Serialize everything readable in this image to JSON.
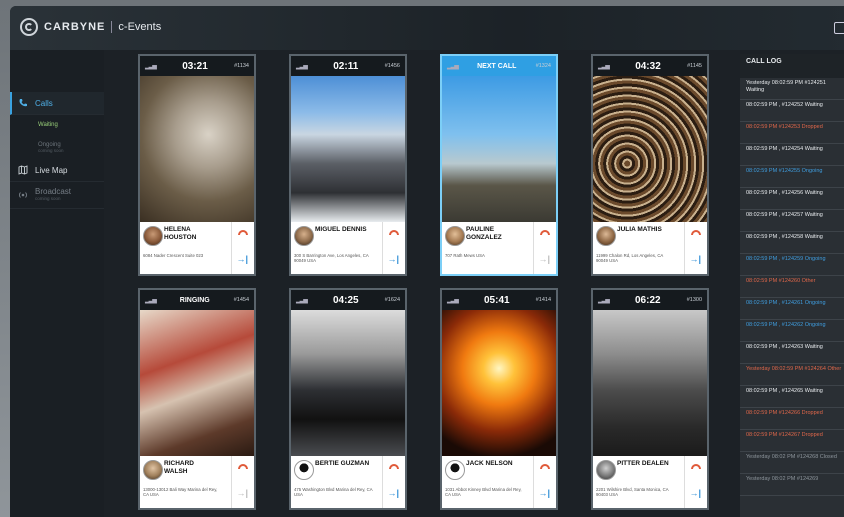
{
  "app": {
    "brand": "CARBYNE",
    "product": "c-Events"
  },
  "sidebar": {
    "items": [
      {
        "label": "Calls",
        "active": true
      },
      {
        "label": "Waiting",
        "sub": true
      },
      {
        "label": "Ongoing",
        "sub": true,
        "note": "coming soon"
      },
      {
        "label": "Live Map"
      },
      {
        "label": "Broadcast",
        "note": "coming soon"
      }
    ]
  },
  "cards": [
    {
      "status": "03:21",
      "id": "#1134",
      "name": "HELENA HOUSTON",
      "address": "6084 Nader Crescent Suite 023",
      "transfer_enabled": true
    },
    {
      "status": "02:11",
      "id": "#1456",
      "name": "MIGUEL DENNIS",
      "address": "300 S Barrington Ave, Los Angeles, CA 90049 USA",
      "transfer_enabled": true
    },
    {
      "status": "NEXT CALL",
      "id": "#1324",
      "name": "PAULINE GONZALEZ",
      "address": "707 Rath Mews USA",
      "transfer_enabled": false,
      "highlight": true
    },
    {
      "status": "04:32",
      "id": "#1145",
      "name": "JULIA MATHIS",
      "address": "11999 Chalon Rd, Los Angeles, CA 90049 USA",
      "transfer_enabled": true
    },
    {
      "status": "RINGING",
      "id": "#1454",
      "name": "RICHARD WALSH",
      "address": "13000-13012 Bali Way Marina del Rey, CA USA",
      "transfer_enabled": false
    },
    {
      "status": "04:25",
      "id": "#1624",
      "name": "BERTIE GUZMAN",
      "address": "475 Washington Blvd Marina del Rey, CA USA",
      "transfer_enabled": true
    },
    {
      "status": "05:41",
      "id": "#1414",
      "name": "JACK NELSON",
      "address": "1031 Abbot Kinney Blvd Marina del Rey, CA USA",
      "transfer_enabled": true
    },
    {
      "status": "06:22",
      "id": "#1300",
      "name": "PITTER DEALEN",
      "address": "2201 Wilshire Blvd, Santa Monica, CA 90403 USA",
      "transfer_enabled": true
    }
  ],
  "call_log": {
    "title": "CALL LOG",
    "entries": [
      {
        "text": "Yesterday 08:02:59 PM #124251 Waiting",
        "kind": "normal"
      },
      {
        "text": "08:02:59 PM , #124252 Waiting",
        "kind": "normal"
      },
      {
        "text": "08:02:59 PM #124253 Dropped",
        "kind": "dropped"
      },
      {
        "text": "08:02:59 PM , #124254 Waiting",
        "kind": "normal"
      },
      {
        "text": "08:02:59 PM #124255 Ongoing",
        "kind": "ongoing"
      },
      {
        "text": "08:02:59 PM , #124256 Waiting",
        "kind": "normal"
      },
      {
        "text": "08:02:59 PM , #124257 Waiting",
        "kind": "normal"
      },
      {
        "text": "08:02:59 PM , #124258 Waiting",
        "kind": "normal"
      },
      {
        "text": "08:02:59 PM , #124259 Ongoing",
        "kind": "ongoing"
      },
      {
        "text": "08:02:59 PM #124260 Other",
        "kind": "dropped"
      },
      {
        "text": "08:02:59 PM , #124261 Ongoing",
        "kind": "ongoing"
      },
      {
        "text": "08:02:59 PM , #124262 Ongoing",
        "kind": "ongoing"
      },
      {
        "text": "08:02:59 PM , #124263 Waiting",
        "kind": "normal"
      },
      {
        "text": "Yesterday 08:02:59 PM #124264 Other",
        "kind": "dropped"
      },
      {
        "text": "08:02:59 PM , #124265 Waiting",
        "kind": "normal"
      },
      {
        "text": "08:02:59 PM #124266 Dropped",
        "kind": "dropped"
      },
      {
        "text": "08:02:59 PM #124267 Dropped",
        "kind": "dropped"
      },
      {
        "text": "Yesterday 08:02 PM #124268 Closed",
        "kind": "closed"
      },
      {
        "text": "Yesterday 08:02 PM #124269",
        "kind": "closed"
      }
    ]
  },
  "colors": {
    "accent": "#2f9fe3",
    "dropped": "#e0674a",
    "waiting": "#9ad17a",
    "sidebar": "#1a1f24"
  }
}
